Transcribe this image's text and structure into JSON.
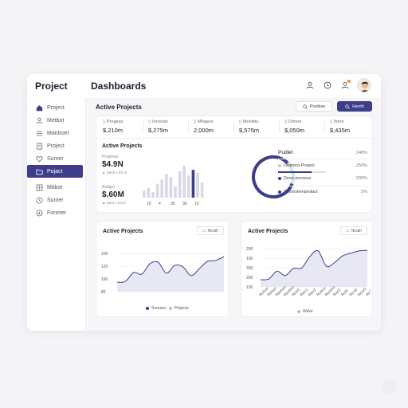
{
  "app": {
    "brand": "Project",
    "page_title": "Dashboards"
  },
  "topbar": {
    "icons": [
      "user-icon",
      "clock-icon",
      "notification-icon"
    ],
    "avatar": "avatar"
  },
  "sidebar": {
    "items": [
      {
        "label": "Project",
        "icon": "home-icon"
      },
      {
        "label": "Metbot",
        "icon": "user-icon"
      },
      {
        "label": "Mantroer",
        "icon": "list-icon"
      },
      {
        "label": "Project",
        "icon": "document-icon"
      },
      {
        "label": "Sumer",
        "icon": "heart-icon"
      },
      {
        "label": "Pojact",
        "icon": "folder-icon",
        "active": true
      },
      {
        "label": "Mitbot",
        "icon": "grid-icon"
      },
      {
        "label": "Sumer",
        "icon": "clock-icon"
      },
      {
        "label": "Fonmer",
        "icon": "plus-circle-icon"
      }
    ]
  },
  "main": {
    "title": "Active Projects",
    "buttons": {
      "outline": "Posltow",
      "primary": "Heoth"
    }
  },
  "stats": [
    {
      "label": "Progess",
      "value": "$,210m"
    },
    {
      "label": "Ironosts",
      "value": "$,275m"
    },
    {
      "label": "Mlogers",
      "value": "2,000m"
    },
    {
      "label": "Moolets",
      "value": "$,575m"
    },
    {
      "label": "Domor",
      "value": "$,050m"
    },
    {
      "label": "Iforor",
      "value": "$,435m"
    }
  ],
  "overview": {
    "title": "Active Projects",
    "progress_label": "Progress",
    "progress_value": "$4.9N",
    "progress_sub": "▲ S0x8 1 ECol",
    "budget_label": "Budget",
    "budget_value": "$.60M",
    "budget_sub": "▲ S0xt 1 ECol",
    "bar_ticks": [
      "10",
      "4",
      "30",
      "30",
      "10"
    ],
    "bar_values": [
      10,
      14,
      8,
      20,
      26,
      34,
      30,
      16,
      38,
      46,
      32,
      40,
      36,
      22
    ],
    "donut_fraction": 0.82,
    "budget_panel": {
      "title": "Pudlet",
      "rows": [
        {
          "label": "",
          "pct": "140%"
        },
        {
          "label": "Dlsktora Project",
          "pct": "250%"
        },
        {
          "label": "Dese pronees",
          "pct": "200%"
        },
        {
          "label": "Smnoslemprolact",
          "pct": "3%"
        }
      ]
    }
  },
  "chart_left": {
    "title": "Active Projects",
    "button": "Neath",
    "legend": [
      "Senraes",
      "Projects"
    ]
  },
  "chart_right": {
    "title": "Active Projects",
    "button": "Neath",
    "legend": [
      "Weke"
    ],
    "x_labels": [
      "Rcitoo",
      "Reitoo",
      "Ramoo",
      "Rantoo",
      "Roc0",
      "Rec1",
      "Rec2",
      "Roitoo",
      "Rentoo",
      "Rec1",
      "Rcl0",
      "Rco0",
      "Rcio0",
      "Rs10"
    ]
  },
  "chart_data": [
    {
      "type": "area",
      "title": "Active Projects",
      "y_ticks": [
        "100",
        "120",
        "100",
        "80"
      ],
      "series": [
        {
          "name": "Senraes",
          "values": [
            30,
            32,
            60,
            55,
            88,
            92,
            58,
            82,
            78,
            50,
            72,
            95,
            98,
            110
          ]
        }
      ],
      "legend": [
        "Senraes",
        "Projects"
      ],
      "grid": true,
      "legend_position": "bottom"
    },
    {
      "type": "area",
      "title": "Active Projects",
      "y_ticks": [
        "200",
        "100",
        "300",
        "200",
        "100"
      ],
      "x": [
        "Rcitoo",
        "Reitoo",
        "Ramoo",
        "Rantoo",
        "Roc0",
        "Rec1",
        "Rec2",
        "Roitoo",
        "Rentoo",
        "Rec1",
        "Rcl0",
        "Rco0",
        "Rcio0",
        "Rs10"
      ],
      "series": [
        {
          "name": "Weke",
          "values": [
            32,
            35,
            70,
            50,
            82,
            84,
            135,
            160,
            92,
            108,
            138,
            150,
            160,
            162
          ]
        }
      ],
      "legend": [
        "Weke"
      ],
      "grid": true,
      "legend_position": "bottom"
    }
  ],
  "colors": {
    "accent": "#3d3d8a",
    "area_fill": "#e4e4f2",
    "donut_teal": "#cdebe4"
  }
}
